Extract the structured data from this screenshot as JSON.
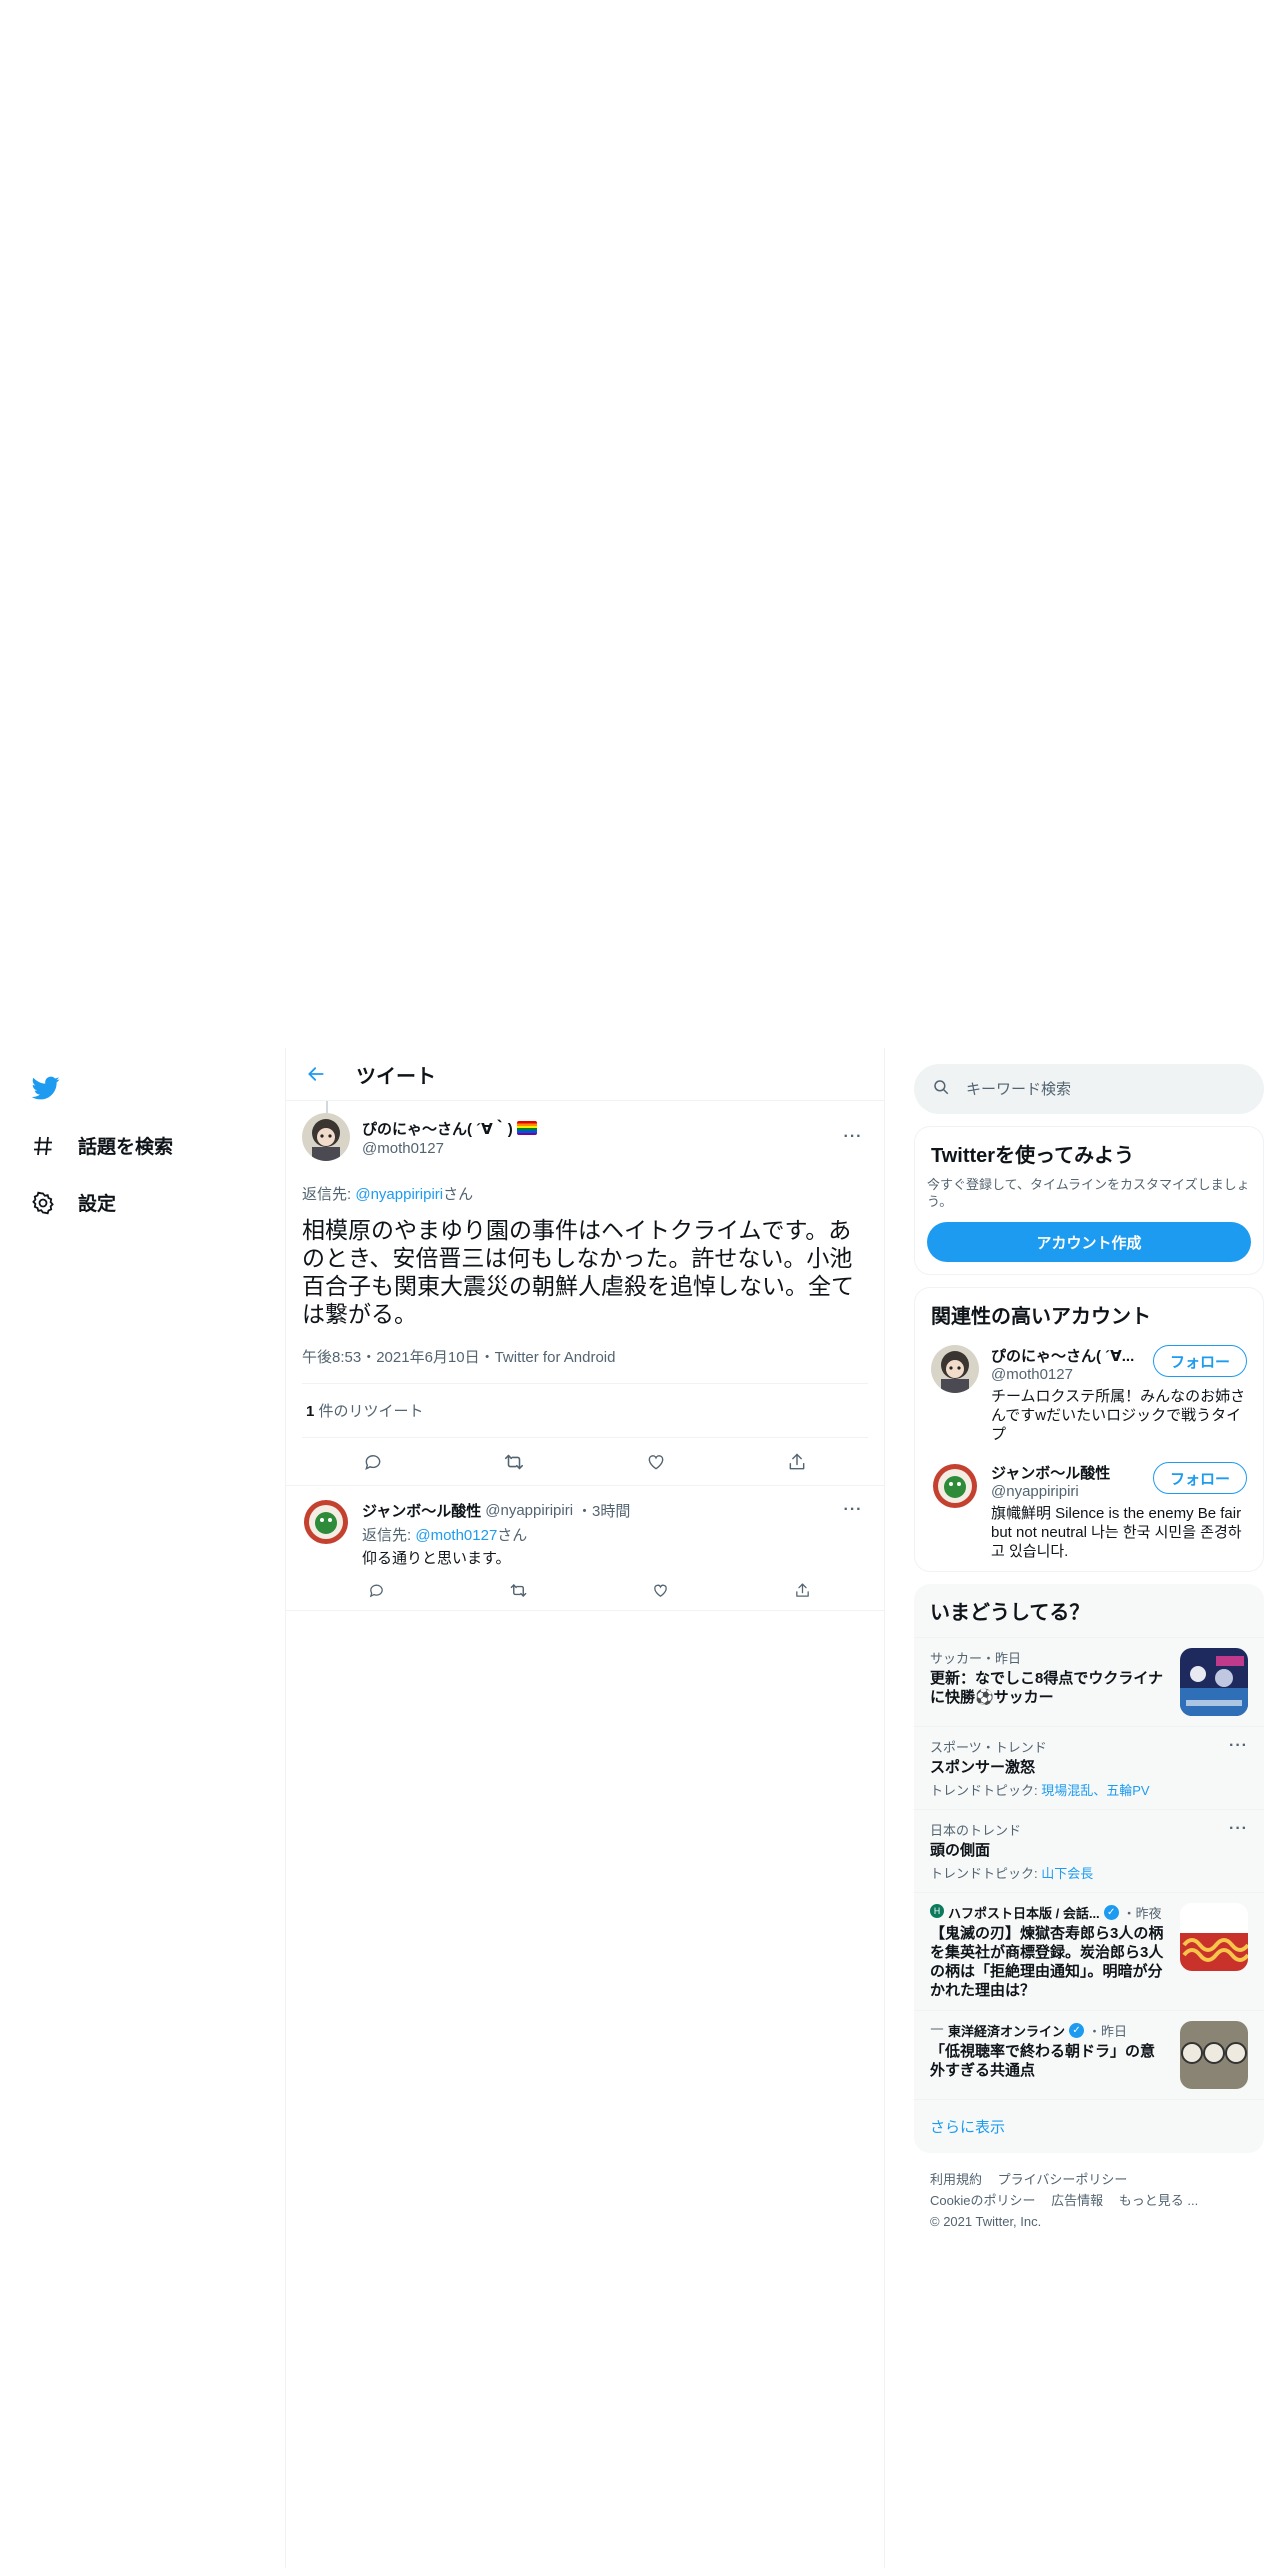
{
  "nav": {
    "explore_label": "話題を検索",
    "settings_label": "設定"
  },
  "header": {
    "title": "ツイート"
  },
  "main_tweet": {
    "author_name": "ぴのにゃ～さん( ´∀｀)",
    "author_handle": "@moth0127",
    "reply_prefix": "返信先: ",
    "reply_handle": "@nyappiripiri",
    "reply_suffix": "さん",
    "text": "相模原のやまゆり園の事件はヘイトクライムです。あのとき、安倍晋三は何もしなかった。許せない。小池百合子も関東大震災の朝鮮人虐殺を追悼しない。全ては繋がる。",
    "meta": "午後8:53・2021年6月10日・Twitter for Android",
    "retweet_count": "1",
    "retweet_label": " 件のリツイート"
  },
  "reply_tweet": {
    "author_name": "ジャンボ～ル酸性",
    "author_handle": "@nyappiripiri",
    "time": "・3時間",
    "reply_prefix": "返信先: ",
    "reply_handle": "@moth0127",
    "reply_suffix": "さん",
    "text": "仰る通りと思います。"
  },
  "search": {
    "placeholder": "キーワード検索"
  },
  "signup": {
    "title": "Twitterを使ってみよう",
    "desc": "今すぐ登録して、タイムラインをカスタマイズしましょう。",
    "button": "アカウント作成"
  },
  "relevant": {
    "title": "関連性の高いアカウント",
    "accounts": [
      {
        "name": "ぴのにゃ～さん( ´∀...",
        "handle": "@moth0127",
        "follow": "フォロー",
        "bio": "チームロクステ所属！みんなのお姉さんですwだいたいロジックで戦うタイプ"
      },
      {
        "name": "ジャンボ～ル酸性",
        "handle": "@nyappiripiri",
        "follow": "フォロー",
        "bio": "旗幟鮮明 Silence is the enemy Be fair but not neutral 나는 한국 시민을 존경하고 있습니다."
      }
    ]
  },
  "trends": {
    "title": "いまどうしてる？",
    "items": [
      {
        "context": "サッカー・昨日",
        "title": "更新：なでしこ8得点でウクライナに快勝⚽サッカー"
      },
      {
        "context": "スポーツ・トレンド",
        "title": "スポンサー激怒",
        "sub_prefix": "トレンドトピック: ",
        "sub_links": "現場混乱、五輪PV"
      },
      {
        "context": "日本のトレンド",
        "title": "頭の側面",
        "sub_prefix": "トレンドトピック: ",
        "sub_links": "山下会長"
      },
      {
        "source": "ハフポスト日本版 / 会話...",
        "time": "・昨夜",
        "title": "【鬼滅の刃】煉獄杏寿郎ら3人の柄を集英社が商標登録。炭治郎ら3人の柄は「拒絶理由通知」。明暗が分かれた理由は？"
      },
      {
        "source": "東洋経済オンライン",
        "time": "・昨日",
        "title": "「低視聴率で終わる朝ドラ」の意外すぎる共通点"
      }
    ],
    "show_more": "さらに表示"
  },
  "footer": {
    "links": [
      "利用規約",
      "プライバシーポリシー",
      "Cookieのポリシー",
      "広告情報",
      "もっと見る ..."
    ],
    "copyright": "© 2021 Twitter, Inc."
  },
  "colors": {
    "accent": "#1d9bf0",
    "text": "#0f1419",
    "muted": "#536471",
    "border": "#eff3f4"
  }
}
